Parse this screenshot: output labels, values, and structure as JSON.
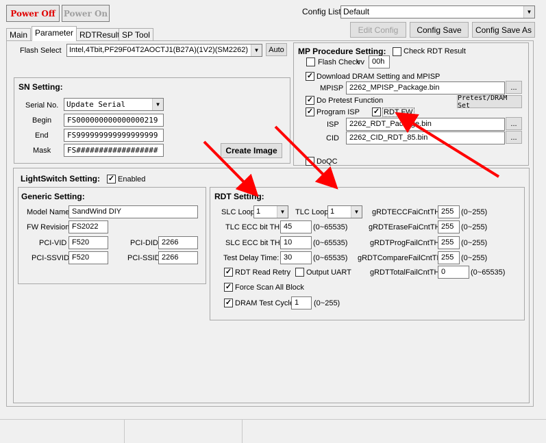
{
  "power_off_label": "Power Off",
  "power_on_label": "Power On",
  "config_list_label": "Config List",
  "config_list_value": "Default",
  "edit_config_label": "Edit Config",
  "config_save_label": "Config Save",
  "config_save_as_label": "Config Save As",
  "tabs": [
    "Main",
    "Parameter",
    "RDTResult",
    "SP Tool"
  ],
  "flash_select_label": "Flash Select",
  "flash_select_value": "Intel,4Tbit,PF29F04T2AOCTJ1(B27A)(1V2)(SM2262)",
  "auto_label": "Auto",
  "sn": {
    "title": "SN Setting:",
    "serial_label": "Serial No.",
    "serial_value": "Update Serial",
    "begin_label": "Begin",
    "begin_value": "FS000000000000000219",
    "end_label": "End",
    "end_value": "FS999999999999999999",
    "mask_label": "Mask",
    "mask_value": "FS##################"
  },
  "create_image_label": "Create Image",
  "mp": {
    "title": "MP Procedure Setting:",
    "check_rdt_result": "Check RDT Result",
    "flash_check": "Flash Check",
    "vv_label": "vv",
    "vv_value": "00h",
    "download_dram": "Download DRAM Setting and MPISP",
    "mpisp_label": "MPISP",
    "mpisp_value": "2262_MPISP_Package.bin",
    "do_pretest": "Do Pretest Function",
    "pretest_button": "Pretest/DRAM Set",
    "program_isp": "Program ISP",
    "rdt_fw": "RDT FW",
    "isp_label": "ISP",
    "isp_value": "2262_RDT_Package.bin",
    "cid_label": "CID",
    "cid_value": "2262_CID_RDT_85.bin",
    "browse": "...",
    "doqc": "DoQC"
  },
  "lightswitch": {
    "title": "LightSwitch Setting:",
    "enabled": "Enabled"
  },
  "generic": {
    "title": "Generic Setting:",
    "model_name_label": "Model Name",
    "model_name_value": "SandWind DIY",
    "fw_revision_label": "FW Revision",
    "fw_revision_value": "FS2022",
    "pci_vid_label": "PCI-VID",
    "pci_vid_value": "F520",
    "pci_did_label": "PCI-DID",
    "pci_did_value": "2266",
    "pci_ssvid_label": "PCI-SSVID",
    "pci_ssvid_value": "F520",
    "pci_ssid_label": "PCI-SSID",
    "pci_ssid_value": "2266"
  },
  "rdt": {
    "title": "RDT Setting:",
    "slc_loop_label": "SLC Loop:",
    "slc_loop_value": "1",
    "tlc_loop_label": "TLC Loop:",
    "tlc_loop_value": "1",
    "tlc_ecc_label": "TLC ECC bit TH:",
    "tlc_ecc_value": "45",
    "tlc_ecc_range": "(0~65535)",
    "slc_ecc_label": "SLC ECC bit TH:",
    "slc_ecc_value": "10",
    "slc_ecc_range": "(0~65535)",
    "test_delay_label": "Test Delay Time:",
    "test_delay_value": "30",
    "test_delay_range": "(0~65535)",
    "rdt_read_retry": "RDT Read Retry",
    "output_uart": "Output UART",
    "force_scan": "Force Scan All Block",
    "dram_test_label": "DRAM Test Cycle:",
    "dram_test_value": "1",
    "dram_test_range": "(0~255)",
    "g_ecc_label": "gRDTECCFaiCntTH:",
    "g_ecc_value": "255",
    "g_ecc_range": "(0~255)",
    "g_erase_label": "gRDTEraseFaiCntTH:",
    "g_erase_value": "255",
    "g_erase_range": "(0~255)",
    "g_prog_label": "gRDTProgFailCntTH:",
    "g_prog_value": "255",
    "g_prog_range": "(0~255)",
    "g_compare_label": "gRDTCompareFailCntTH:",
    "g_compare_value": "255",
    "g_compare_range": "(0~255)",
    "g_total_label": "gRDTTotalFailCntTH:",
    "g_total_value": "0",
    "g_total_range": "(0~65535)"
  },
  "annotation_color": "#ff0000"
}
